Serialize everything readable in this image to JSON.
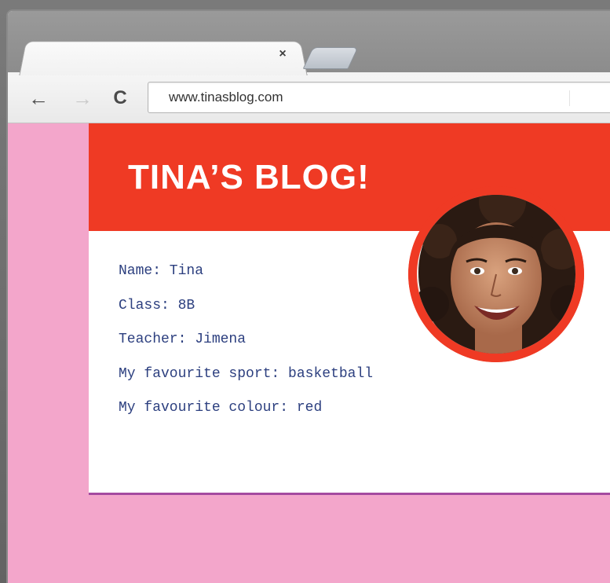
{
  "browser": {
    "tab_close_glyph": "×",
    "url": "www.tinasblog.com",
    "back_glyph": "←",
    "forward_glyph": "→",
    "reload_glyph": "C"
  },
  "page": {
    "background_color": "#f3a6cb",
    "header_color": "#ef3a24",
    "title": "TINA’S BLOG!",
    "profile_lines": [
      "Name: Tina",
      "Class: 8B",
      "Teacher: Jimena",
      "My favourite sport: basketball",
      "My favourite colour: red"
    ]
  }
}
